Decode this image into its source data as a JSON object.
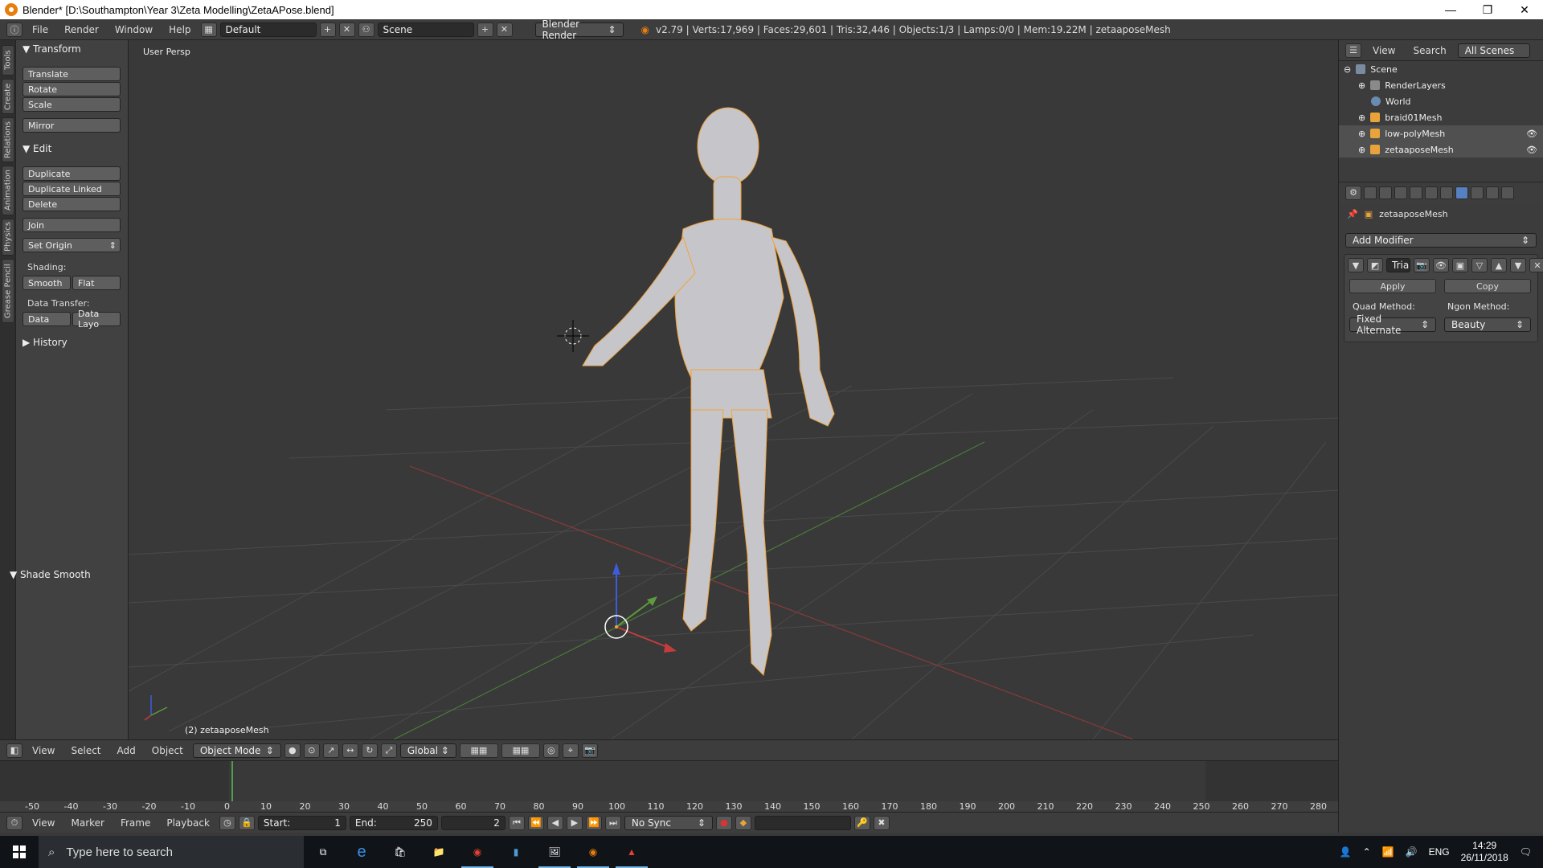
{
  "window": {
    "title": "Blender* [D:\\Southampton\\Year 3\\Zeta Modelling\\ZetaAPose.blend]",
    "minimize": "—",
    "maximize": "❐",
    "close": "✕"
  },
  "infobar": {
    "menus": [
      "File",
      "Render",
      "Window",
      "Help"
    ],
    "layout": "Default",
    "scene": "Scene",
    "engine": "Blender Render",
    "stats": "v2.79 | Verts:17,969 | Faces:29,601 | Tris:32,446 | Objects:1/3 | Lamps:0/0 | Mem:19.22M | zetaaposeMesh"
  },
  "tabs": [
    "Tools",
    "Create",
    "Relations",
    "Animation",
    "Physics",
    "Grease Pencil"
  ],
  "toolshelf": {
    "transform_header": "Transform",
    "translate": "Translate",
    "rotate": "Rotate",
    "scale": "Scale",
    "mirror": "Mirror",
    "edit_header": "Edit",
    "duplicate": "Duplicate",
    "duplicate_linked": "Duplicate Linked",
    "delete": "Delete",
    "join": "Join",
    "set_origin": "Set Origin",
    "shading_label": "Shading:",
    "smooth": "Smooth",
    "flat": "Flat",
    "data_transfer_label": "Data Transfer:",
    "data": "Data",
    "data_layout": "Data Layo",
    "history_header": "History",
    "shade_smooth_header": "Shade Smooth"
  },
  "viewport": {
    "view_label": "User Persp",
    "object_label": "(2) zetaaposeMesh"
  },
  "viewheader": {
    "menus": [
      "View",
      "Select",
      "Add",
      "Object"
    ],
    "mode": "Object Mode",
    "orientation": "Global"
  },
  "timeline": {
    "ticks": [
      "-50",
      "-40",
      "-30",
      "-20",
      "-10",
      "0",
      "10",
      "20",
      "30",
      "40",
      "50",
      "60",
      "70",
      "80",
      "90",
      "100",
      "110",
      "120",
      "130",
      "140",
      "150",
      "160",
      "170",
      "180",
      "190",
      "200",
      "210",
      "220",
      "230",
      "240",
      "250",
      "260",
      "270",
      "280"
    ],
    "menus": [
      "View",
      "Marker",
      "Frame",
      "Playback"
    ],
    "start_label": "Start:",
    "start_value": "1",
    "end_label": "End:",
    "end_value": "250",
    "current": "2",
    "sync": "No Sync"
  },
  "outliner": {
    "menus": [
      "View",
      "Search"
    ],
    "filter": "All Scenes",
    "items": [
      {
        "label": "Scene"
      },
      {
        "label": "RenderLayers"
      },
      {
        "label": "World"
      },
      {
        "label": "braid01Mesh"
      },
      {
        "label": "low-polyMesh"
      },
      {
        "label": "zetaaposeMesh"
      }
    ]
  },
  "properties": {
    "object": "zetaaposeMesh",
    "add_modifier": "Add Modifier",
    "modifier_name": "Tria",
    "apply": "Apply",
    "copy": "Copy",
    "quad_label": "Quad Method:",
    "ngon_label": "Ngon Method:",
    "quad_value": "Fixed Alternate",
    "ngon_value": "Beauty"
  },
  "taskbar": {
    "search_placeholder": "Type here to search",
    "lang": "ENG",
    "time": "14:29",
    "date": "26/11/2018"
  },
  "colors": {
    "accent": "#5680c2",
    "selection": "#f2a33a",
    "x_axis": "#c43c3c",
    "y_axis": "#5c9c3c",
    "z_axis": "#3c5cd8"
  }
}
